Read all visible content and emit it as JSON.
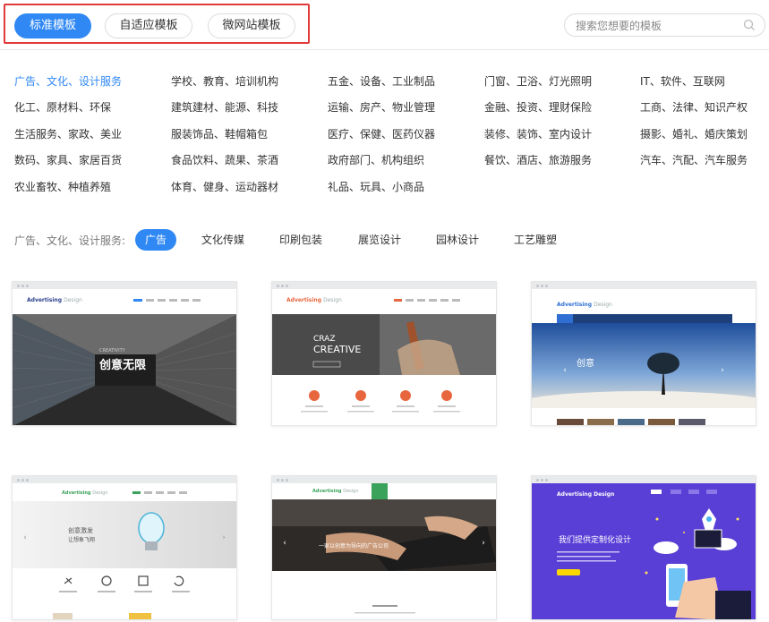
{
  "top_tabs": [
    {
      "label": "标准模板",
      "active": true
    },
    {
      "label": "自适应模板",
      "active": false
    },
    {
      "label": "微网站模板",
      "active": false
    }
  ],
  "search": {
    "placeholder": "搜索您想要的模板"
  },
  "categories": [
    [
      "广告、文化、设计服务",
      "学校、教育、培训机构",
      "五金、设备、工业制品",
      "门窗、卫浴、灯光照明",
      "IT、软件、互联网"
    ],
    [
      "化工、原材料、环保",
      "建筑建材、能源、科技",
      "运输、房产、物业管理",
      "金融、投资、理财保险",
      "工商、法律、知识产权"
    ],
    [
      "生活服务、家政、美业",
      "服装饰品、鞋帽箱包",
      "医疗、保健、医药仪器",
      "装修、装饰、室内设计",
      "摄影、婚礼、婚庆策划"
    ],
    [
      "数码、家具、家居百货",
      "食品饮料、蔬果、茶酒",
      "政府部门、机构组织",
      "餐饮、酒店、旅游服务",
      "汽车、汽配、汽车服务"
    ],
    [
      "农业畜牧、种植养殖",
      "体育、健身、运动器材",
      "礼品、玩具、小商品"
    ]
  ],
  "active_category": "广告、文化、设计服务",
  "subfilter": {
    "label": "广告、文化、设计服务:",
    "items": [
      "广告",
      "文化传媒",
      "印刷包装",
      "展览设计",
      "园林设计",
      "工艺雕塑"
    ],
    "active": "广告"
  },
  "cards": [
    {
      "logo_a": "Advertising",
      "logo_b": "Design",
      "caption": "创意无限",
      "sub": "CREATIVITY"
    },
    {
      "logo_a": "Advertising",
      "logo_b": "Design",
      "caption": "CREATIVE",
      "sub": "CRAZ"
    },
    {
      "logo_a": "Advertising",
      "logo_b": "Design",
      "caption": "创意",
      "sub": ""
    },
    {
      "logo_a": "Advertising",
      "logo_b": "Design",
      "caption": "创意激发",
      "sub": "让想象飞翔"
    },
    {
      "logo_a": "Advertising",
      "logo_b": "Design",
      "caption": "一家以创意为导向的广告公司",
      "sub": ""
    },
    {
      "logo_a": "Advertising Design",
      "logo_b": "",
      "caption": "我们提供定制化设计",
      "sub": ""
    }
  ],
  "colors": {
    "accent": "#2f88f3",
    "highlight_border": "#e23a3a"
  }
}
